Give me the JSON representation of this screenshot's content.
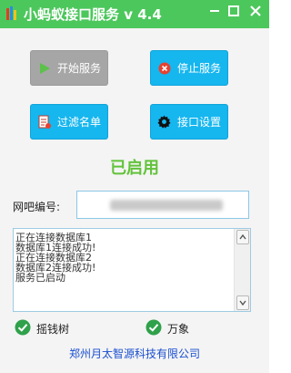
{
  "window": {
    "title": "小蚂蚁接口服务 v 4.4"
  },
  "buttons": {
    "start": "开始服务",
    "stop": "停止服务",
    "filter": "过滤名单",
    "config": "接口设置"
  },
  "status": "已启用",
  "wangba": {
    "label": "网吧编号:"
  },
  "log": {
    "lines": "正在连接数据库1\n数据库1连接成功!\n正在连接数据库2\n数据库2连接成功!\n服务已启动"
  },
  "checks": [
    {
      "label": "摇钱树",
      "checked": true
    },
    {
      "label": "万象",
      "checked": true
    }
  ],
  "footer": "郑州月太智源科技有限公司",
  "colors": {
    "titlebar": "#4cc75c",
    "button": "#16b6ef",
    "disabled": "#a6a6a6",
    "status": "#62c33b",
    "footer": "#1a4fd0"
  }
}
